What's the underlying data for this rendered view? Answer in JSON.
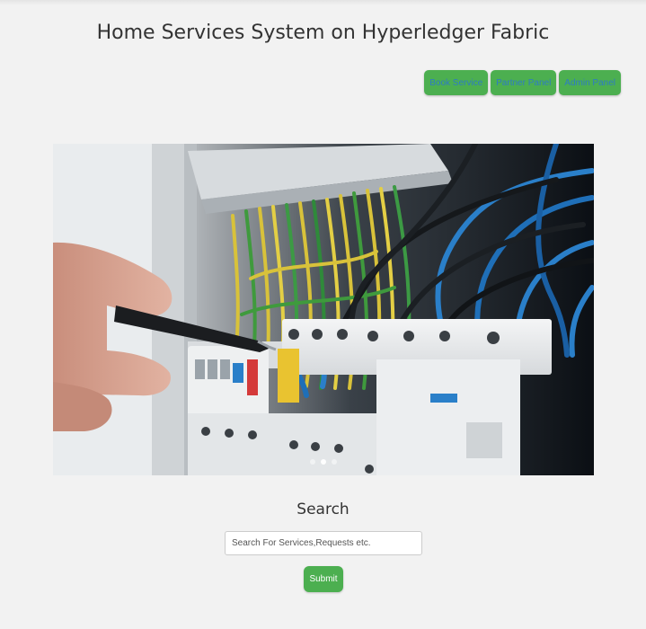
{
  "header": {
    "title": "Home Services System on Hyperledger Fabric"
  },
  "nav": {
    "items": [
      {
        "label": "Book Service"
      },
      {
        "label": "Partner Panel"
      },
      {
        "label": "Admin Panel"
      }
    ]
  },
  "carousel": {
    "image": "electrical-panel-photo",
    "slide_count": 3,
    "active_index": 1
  },
  "search": {
    "heading": "Search",
    "placeholder": "Search For Services,Requests etc.",
    "value": "",
    "submit_label": "Submit"
  },
  "colors": {
    "background": "#f2f2f2",
    "button_green": "#4caf50",
    "nav_text": "#2e7bc4",
    "title_text": "#333333"
  }
}
